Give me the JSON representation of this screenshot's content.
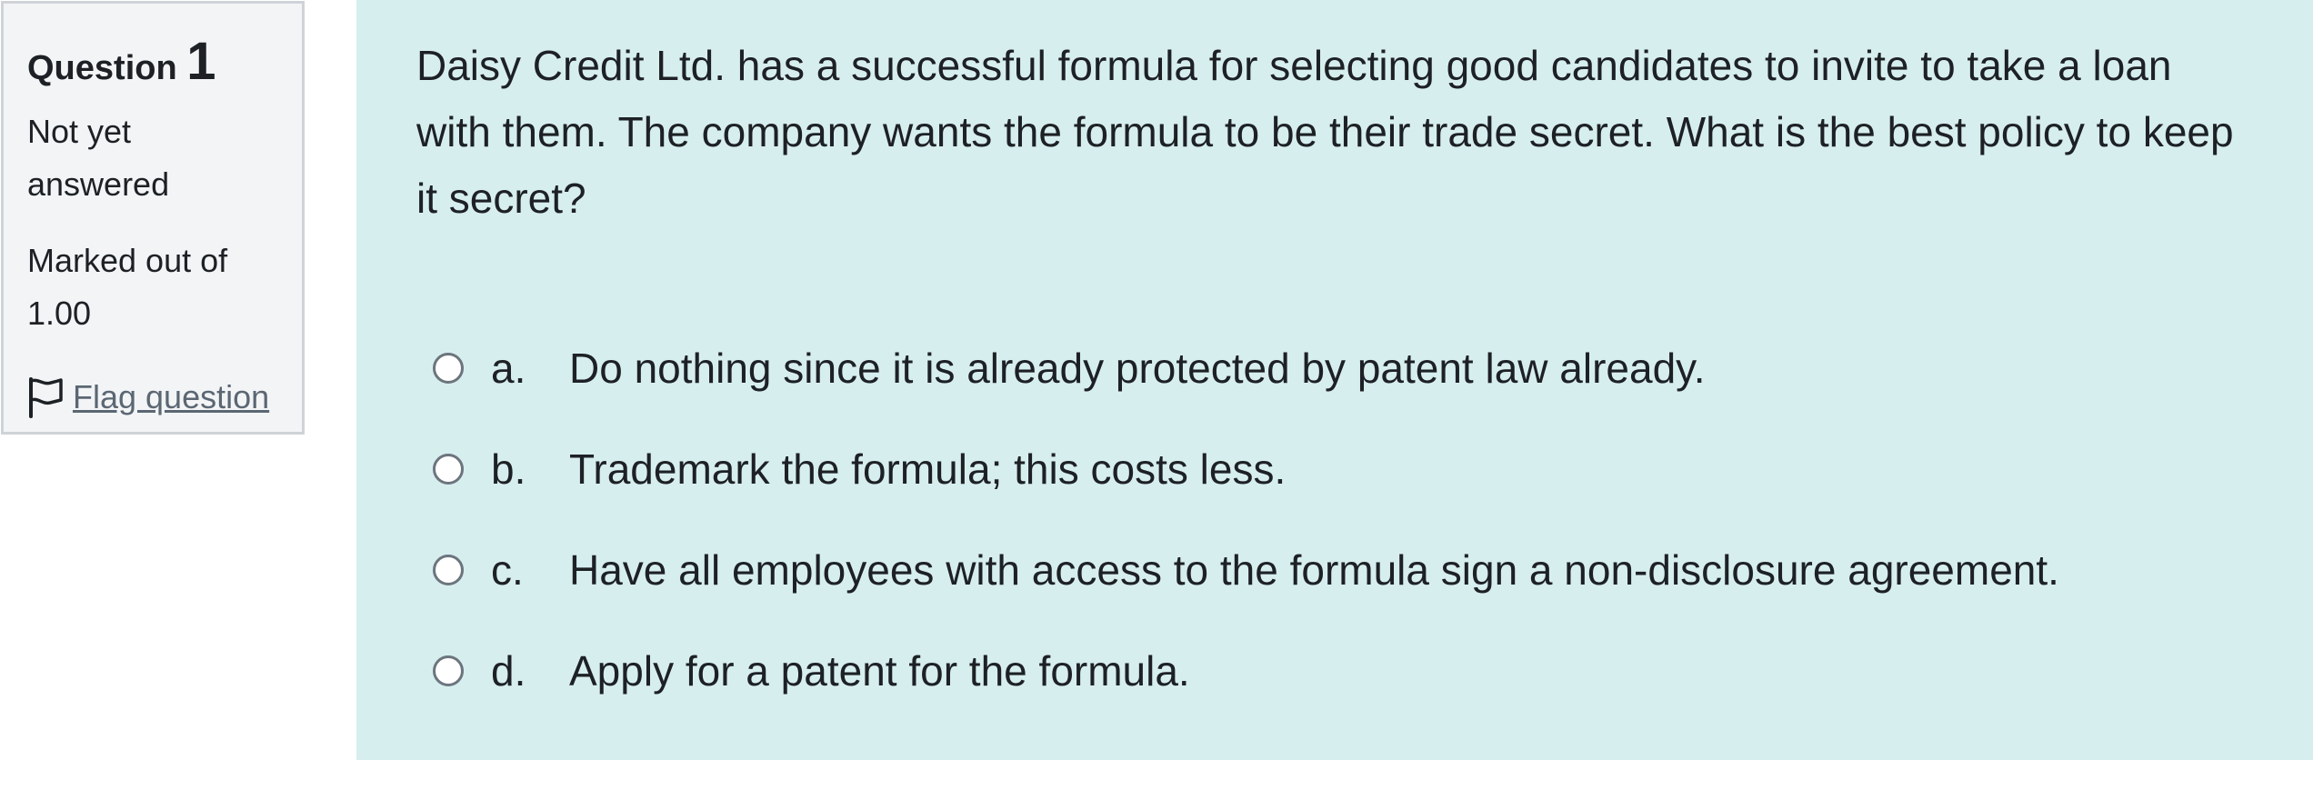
{
  "info": {
    "heading_prefix": "Question",
    "number": "1",
    "state": "Not yet answered",
    "grade": "Marked out of 1.00",
    "flag_label": "Flag question",
    "flag_icon": "flag-outline-icon"
  },
  "question": {
    "text": "Daisy Credit Ltd. has a successful formula for selecting good candidates to invite to take a loan with them. The company wants the formula to be their trade secret. What is the best policy to keep it secret?",
    "answers": [
      {
        "letter": "a.",
        "text": "Do nothing since it is already protected by patent law already."
      },
      {
        "letter": "b.",
        "text": "Trademark the formula; this costs less."
      },
      {
        "letter": "c.",
        "text": "Have all employees with access to the formula sign a non-disclosure agreement."
      },
      {
        "letter": "d.",
        "text": "Apply for a patent for the formula."
      }
    ]
  },
  "colors": {
    "info_background": "#f2f4f6",
    "info_border": "#cfd3d7",
    "content_background": "#d7eeef",
    "text": "#1d2125",
    "link": "#5b6773",
    "radio_border": "#6c757d"
  }
}
